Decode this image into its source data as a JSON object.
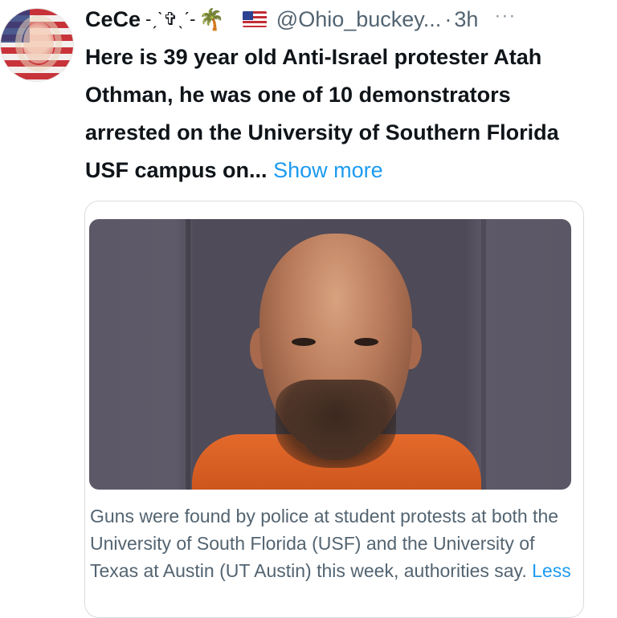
{
  "tweet": {
    "display_name": "CeCe",
    "name_decoration": "-ˏˋ✞ˎˊ-",
    "palm_emoji": "🌴",
    "flag_icon": "us-flag-icon",
    "handle": "@Ohio_buckey...",
    "separator": "·",
    "time": "3h",
    "more_icon": "···",
    "text": "Here is 39 year old Anti-Israel protester Atah Othman, he was one of 10 demonstrators arrested on the University of Southern Florida USF campus on...",
    "show_more": "Show more"
  },
  "card": {
    "image_alt_icon": "mugshot-image",
    "description": "Guns were found by police at student protests at both the University of South Florida (USF) and the University of Texas at Austin (UT Austin) this week, authorities say.",
    "less_label": "Less"
  },
  "colors": {
    "link": "#1d9bf0",
    "secondary_text": "#536471",
    "primary_text": "#0f1419",
    "card_border": "#d8dde1"
  }
}
